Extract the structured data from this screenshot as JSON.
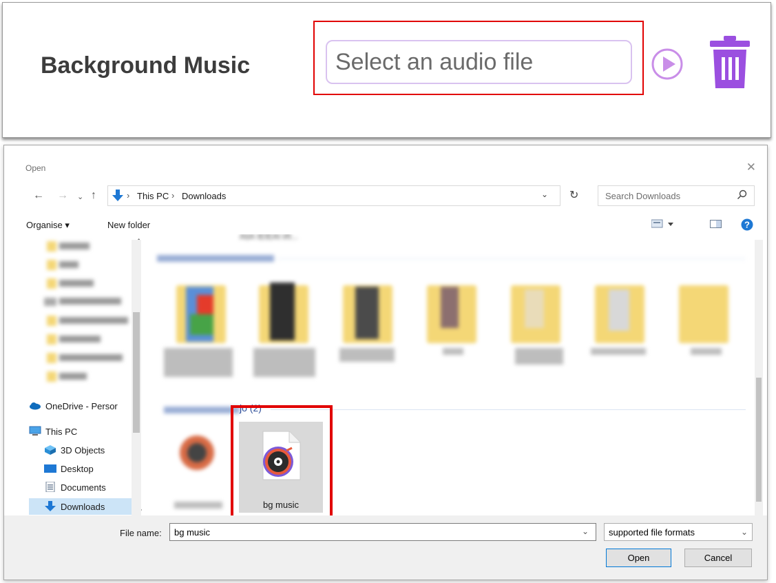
{
  "music_panel": {
    "label": "Background Music",
    "input_placeholder": "Select an audio file",
    "accent_color": "#9b4fe0"
  },
  "dialog": {
    "title": "Open",
    "address": {
      "segments": [
        "This PC",
        "Downloads"
      ]
    },
    "search_placeholder": "Search Downloads",
    "toolbar": {
      "organise": "Organise ▾",
      "new_folder": "New folder"
    },
    "nav_items": [
      {
        "label": "OneDrive - Persor",
        "icon": "cloud-icon"
      },
      {
        "label": "This PC",
        "icon": "computer-icon"
      },
      {
        "label": "3D Objects",
        "icon": "cube-icon"
      },
      {
        "label": "Desktop",
        "icon": "desktop-icon"
      },
      {
        "label": "Documents",
        "icon": "document-icon"
      },
      {
        "label": "Downloads",
        "icon": "download-icon",
        "selected": true
      }
    ],
    "group_partial_suffix": "jo (2)",
    "partial_top_label": "AšА ІЕІЕАІ ИІ...",
    "selected_file": "bg music",
    "file_name_label": "File name:",
    "file_name_value": "bg music",
    "file_type": "supported file formats",
    "open_label": "Open",
    "cancel_label": "Cancel"
  }
}
